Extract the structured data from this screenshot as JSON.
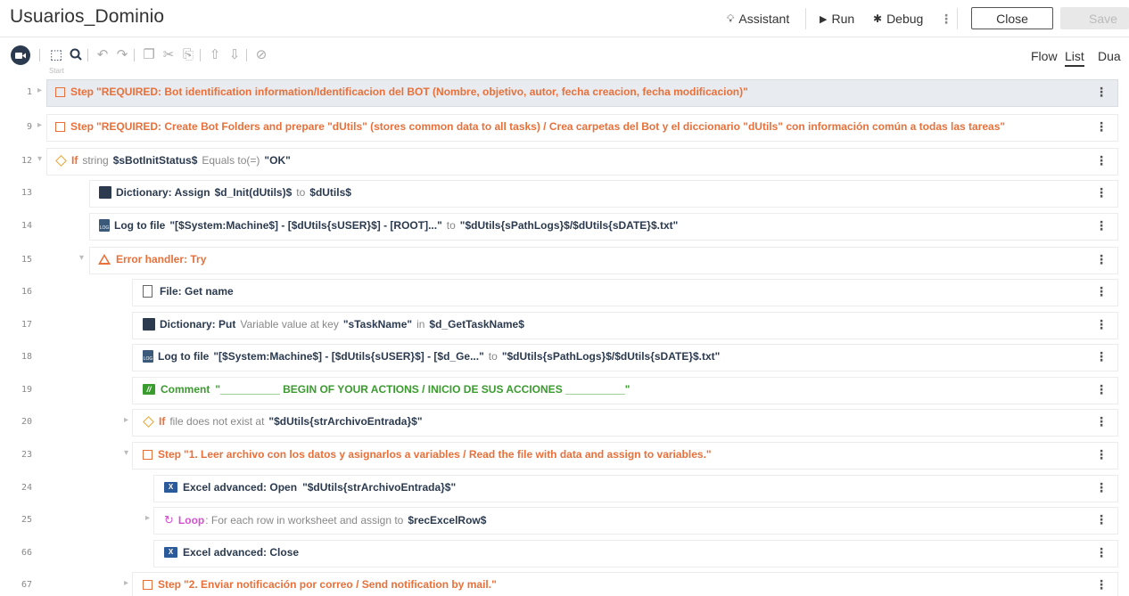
{
  "header": {
    "title": "Usuarios_Dominio",
    "assistant_label": "Assistant",
    "run_label": "Run",
    "debug_label": "Debug",
    "close_label": "Close",
    "save_label": "Save"
  },
  "toolbar": {
    "start_label": "Start",
    "tabs": [
      "Flow",
      "List",
      "Dua"
    ],
    "active_tab": "List"
  },
  "rows": [
    {
      "line": "1",
      "prefix": "Step",
      "quoted": "\"REQUIRED: Bot identification information/Identificacion del BOT (Nombre, objetivo, autor, fecha creacion, fecha modificacion)\""
    },
    {
      "line": "9",
      "prefix": "Step",
      "quoted": "\"REQUIRED: Create Bot Folders and prepare \"dUtils\" (stores common data to all tasks) / Crea carpetas del Bot y el diccionario \"dUtils\" con información común a todas las tareas\""
    },
    {
      "line": "12",
      "kw": "If",
      "t1": "string",
      "v1": "$sBotInitStatus$",
      "t2": "Equals to(=)",
      "v2": "\"OK\""
    },
    {
      "line": "13",
      "kw": "Dictionary: Assign",
      "v1": "$d_Init(dUtils)$",
      "t1": "to",
      "v2": "$dUtils$"
    },
    {
      "line": "14",
      "kw": "Log to file",
      "v1": "\"[$System:Machine$] - [$dUtils{sUSER}$] - [ROOT]...\"",
      "t1": "to",
      "v2": "\"$dUtils{sPathLogs}$/$dUtils{sDATE}$.txt\""
    },
    {
      "line": "15",
      "kw": "Error handler: Try"
    },
    {
      "line": "16",
      "kw": "File: Get name"
    },
    {
      "line": "17",
      "kw": "Dictionary: Put",
      "t1": "Variable value at key",
      "v1": "\"sTaskName\"",
      "t2": "in",
      "v2": "$d_GetTaskName$"
    },
    {
      "line": "18",
      "kw": "Log to file",
      "v1": "\"[$System:Machine$] - [$dUtils{sUSER}$] - [$d_Ge...\"",
      "t1": "to",
      "v2": "\"$dUtils{sPathLogs}$/$dUtils{sDATE}$.txt\""
    },
    {
      "line": "19",
      "kw": "Comment",
      "v1": "\"__________ BEGIN OF YOUR ACTIONS / INICIO DE SUS ACCIONES __________\""
    },
    {
      "line": "20",
      "kw": "If",
      "t1": "file does not exist at",
      "v1": "\"$dUtils{strArchivoEntrada}$\""
    },
    {
      "line": "23",
      "prefix": "Step",
      "quoted": "\"1. Leer archivo con los datos y asignarlos a variables / Read the file with data and assign to variables.\""
    },
    {
      "line": "24",
      "kw": "Excel advanced: Open",
      "v1": "\"$dUtils{strArchivoEntrada}$\""
    },
    {
      "line": "25",
      "kw": "Loop",
      "t1": ": For each row in worksheet and assign to",
      "v1": "$recExcelRow$"
    },
    {
      "line": "66",
      "kw": "Excel advanced: Close"
    },
    {
      "line": "67",
      "prefix": "Step",
      "quoted": "\"2. Enviar notificación por correo / Send notification by mail.\""
    }
  ],
  "colors": {
    "step": "#e8703a",
    "condition": "#f0a32a",
    "loop": "#d352d0",
    "comment": "#3a9b2e",
    "highlight_row": "#e8ebef"
  }
}
